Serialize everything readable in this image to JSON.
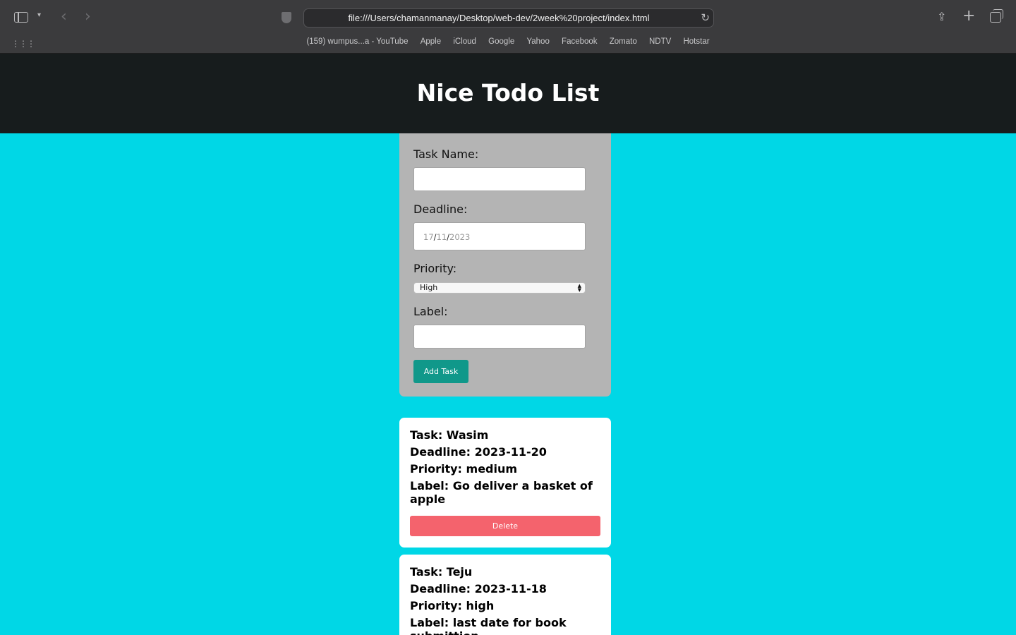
{
  "browser": {
    "url": "file:///Users/chamanmanay/Desktop/web-dev/2week%20project/index.html",
    "bookmarks": [
      "(159) wumpus...a - YouTube",
      "Apple",
      "iCloud",
      "Google",
      "Yahoo",
      "Facebook",
      "Zomato",
      "NDTV",
      "Hotstar"
    ]
  },
  "page": {
    "title": "Nice Todo List"
  },
  "form": {
    "task_name_label": "Task Name:",
    "task_name_value": "",
    "deadline_label": "Deadline:",
    "deadline_day": "17",
    "deadline_month": "11",
    "deadline_year": "2023",
    "date_sep": "/",
    "priority_label": "Priority:",
    "priority_value": "High",
    "label_label": "Label:",
    "label_value": "",
    "add_button": "Add Task"
  },
  "tasks": [
    {
      "task": "Task: Wasim",
      "deadline": "Deadline: 2023-11-20",
      "priority": "Priority: medium",
      "label": "Label: Go deliver a basket of apple",
      "delete": "Delete"
    },
    {
      "task": "Task: Teju",
      "deadline": "Deadline: 2023-11-18",
      "priority": "Priority: high",
      "label": "Label: last date for book submittion"
    }
  ],
  "colors": {
    "background": "#00d7e6",
    "header": "#171c1d",
    "form_card": "#b4b4b4",
    "add_button": "#10988a",
    "delete_button": "#f4636d"
  }
}
